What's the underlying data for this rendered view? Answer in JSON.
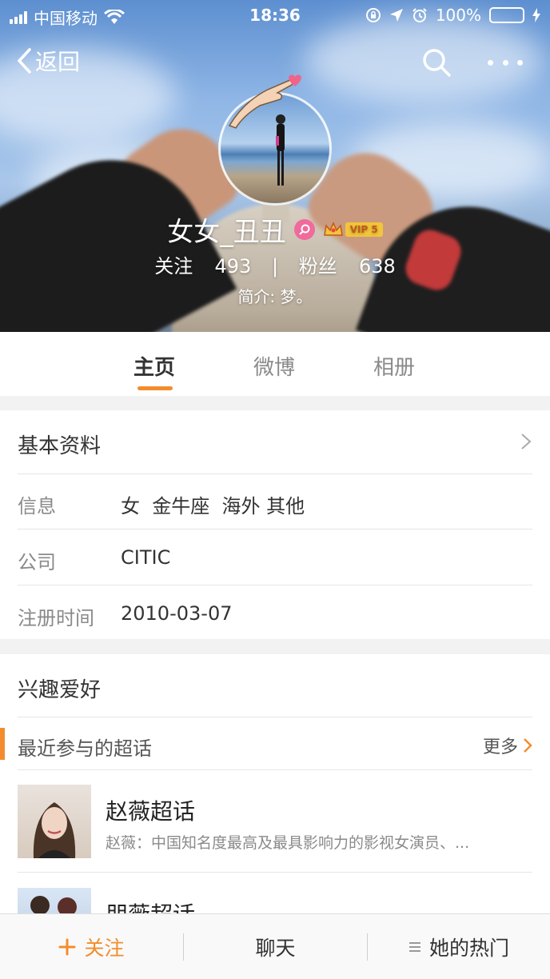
{
  "status_bar": {
    "carrier": "中国移动",
    "time": "18:36",
    "battery": "100%"
  },
  "nav": {
    "back_label": "返回"
  },
  "profile": {
    "username": "女女_丑丑",
    "vip_label": "VIP 5",
    "following_label": "关注",
    "following_count": "493",
    "separator": "|",
    "followers_label": "粉丝",
    "followers_count": "638",
    "bio": "简介: 梦。"
  },
  "tabs": [
    {
      "label": "主页",
      "active": true
    },
    {
      "label": "微博",
      "active": false
    },
    {
      "label": "相册",
      "active": false
    }
  ],
  "basic_info": {
    "title": "基本资料",
    "rows": [
      {
        "label": "信息",
        "value": "女  金牛座  海外 其他"
      },
      {
        "label": "公司",
        "value": "CITIC"
      },
      {
        "label": "注册时间",
        "value": "2010-03-07"
      }
    ]
  },
  "interests": {
    "title": "兴趣爱好",
    "recent_title": "最近参与的超话",
    "more_label": "更多",
    "topics": [
      {
        "title": "赵薇超话",
        "desc": "赵薇：中国知名度最高及最具影响力的影视女演员、..."
      },
      {
        "title": "朋薇超话",
        "desc": ""
      }
    ]
  },
  "bottom_bar": {
    "follow_label": "关注",
    "chat_label": "聊天",
    "hot_label": "她的热门"
  },
  "colors": {
    "accent": "#f28d2e",
    "battery_green": "#4cd964",
    "vip_gold": "#f2c53a",
    "badge_pink": "#f06a9b"
  },
  "icons": [
    "signal-icon",
    "wifi-icon",
    "lock-rotation-icon",
    "location-icon",
    "alarm-icon",
    "battery-icon",
    "charging-icon",
    "back-chevron-icon",
    "search-icon",
    "more-dots-icon",
    "chevron-right-icon",
    "plus-icon",
    "menu-lines-icon",
    "crown-icon"
  ]
}
